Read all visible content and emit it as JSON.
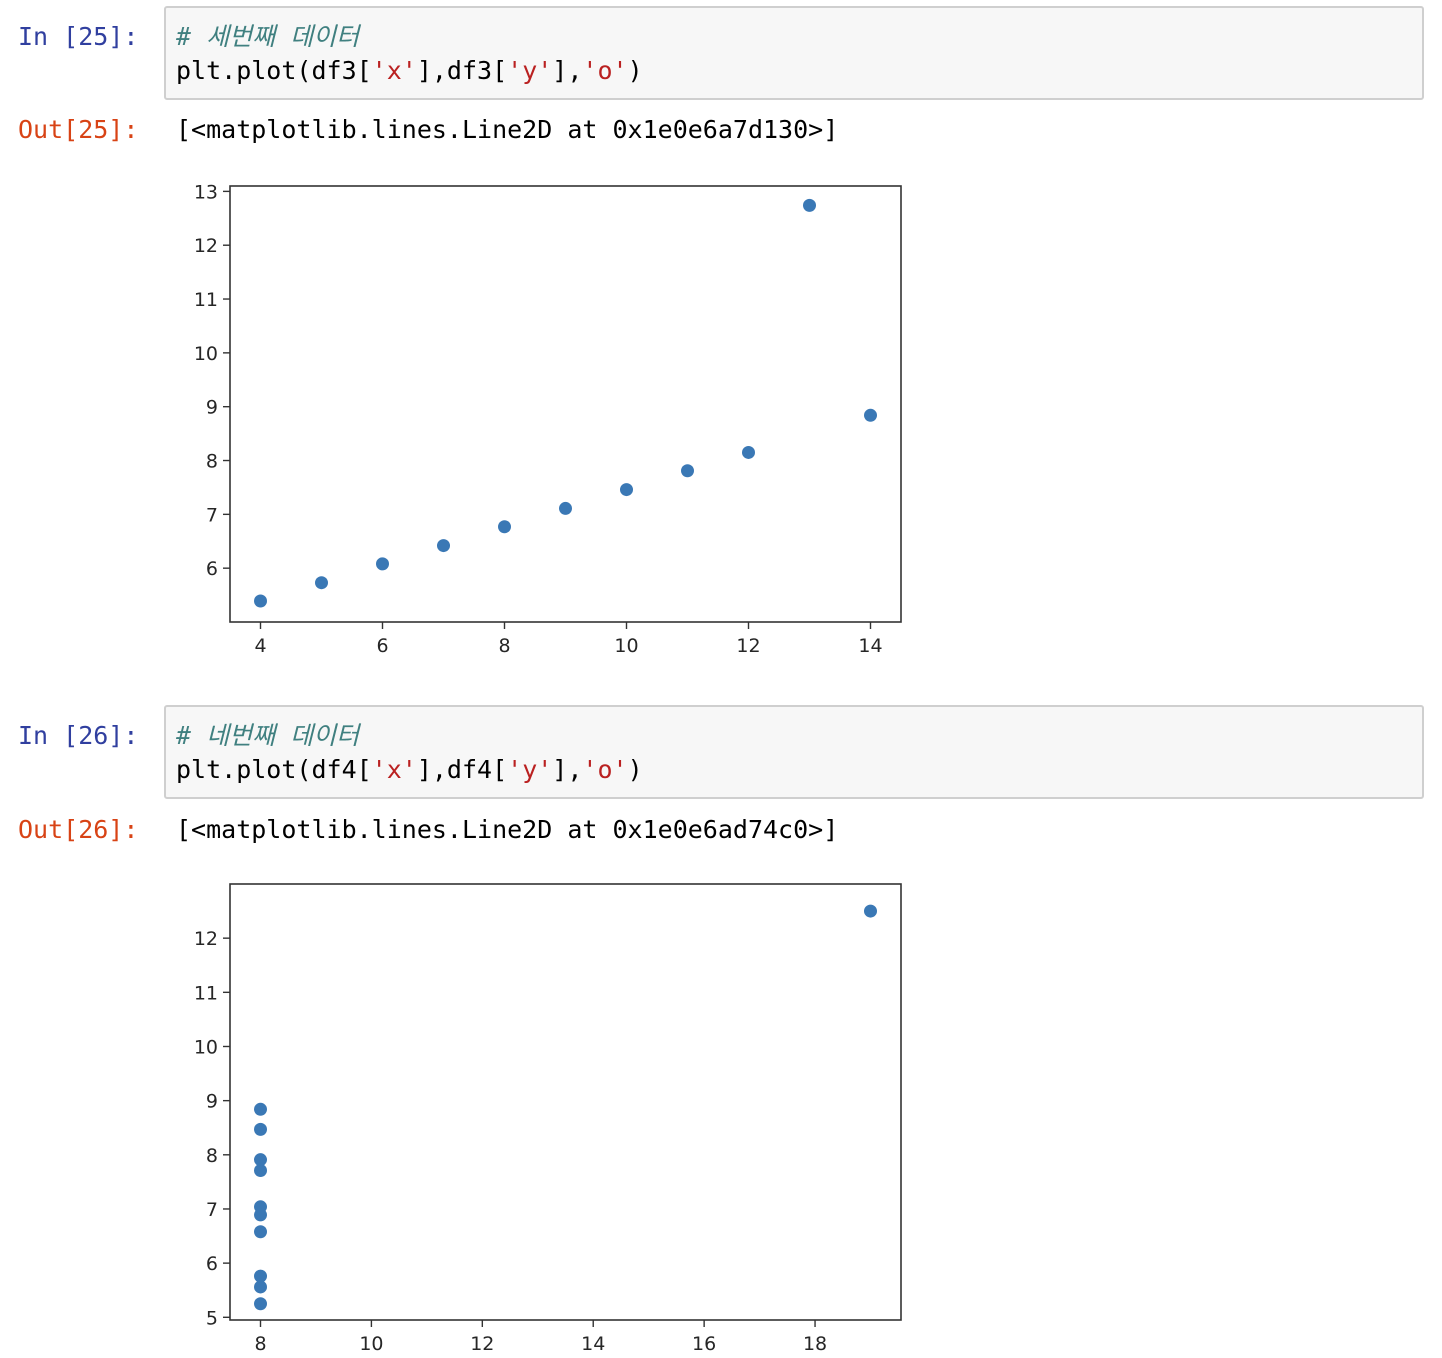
{
  "cells": [
    {
      "in_prompt": "In [25]:",
      "comment": "# 세번째 데이터",
      "code": {
        "p1": "plt.plot(df3[",
        "s1": "'x'",
        "p2": "],df3[",
        "s2": "'y'",
        "p3": "],",
        "s3": "'o'",
        "p4": ")"
      },
      "out_prompt": "Out[25]:",
      "output": "[<matplotlib.lines.Line2D at 0x1e0e6a7d130>]"
    },
    {
      "in_prompt": "In [26]:",
      "comment": "# 네번째 데이터",
      "code": {
        "p1": "plt.plot(df4[",
        "s1": "'x'",
        "p2": "],df4[",
        "s2": "'y'",
        "p3": "],",
        "s3": "'o'",
        "p4": ")"
      },
      "out_prompt": "Out[26]:",
      "output": "[<matplotlib.lines.Line2D at 0x1e0e6ad74c0>]"
    }
  ],
  "colors": {
    "marker": "#3a78b5",
    "axis": "#333333",
    "in_prompt": "#303f9f",
    "out_prompt": "#d84315",
    "comment": "#408080",
    "string": "#ba2121"
  },
  "chart_data": [
    {
      "type": "scatter",
      "xlabel": "",
      "ylabel": "",
      "xlim": [
        3.5,
        14.5
      ],
      "ylim": [
        5.0,
        13.1
      ],
      "xticks": [
        4,
        6,
        8,
        10,
        12,
        14
      ],
      "yticks": [
        6,
        7,
        8,
        9,
        10,
        11,
        12,
        13
      ],
      "x": [
        10,
        8,
        13,
        9,
        11,
        14,
        6,
        4,
        12,
        7,
        5
      ],
      "y": [
        7.46,
        6.77,
        12.74,
        7.11,
        7.81,
        8.84,
        6.08,
        5.39,
        8.15,
        6.42,
        5.73
      ],
      "grid": false
    },
    {
      "type": "scatter",
      "xlabel": "",
      "ylabel": "",
      "xlim": [
        7.45,
        19.55
      ],
      "ylim": [
        4.95,
        13.0
      ],
      "xticks": [
        8,
        10,
        12,
        14,
        16,
        18
      ],
      "yticks": [
        5,
        6,
        7,
        8,
        9,
        10,
        11,
        12
      ],
      "x": [
        8,
        8,
        8,
        8,
        8,
        8,
        8,
        19,
        8,
        8,
        8
      ],
      "y": [
        6.58,
        5.76,
        7.71,
        8.84,
        8.47,
        7.04,
        5.25,
        12.5,
        5.56,
        7.91,
        6.89
      ],
      "grid": false
    }
  ]
}
